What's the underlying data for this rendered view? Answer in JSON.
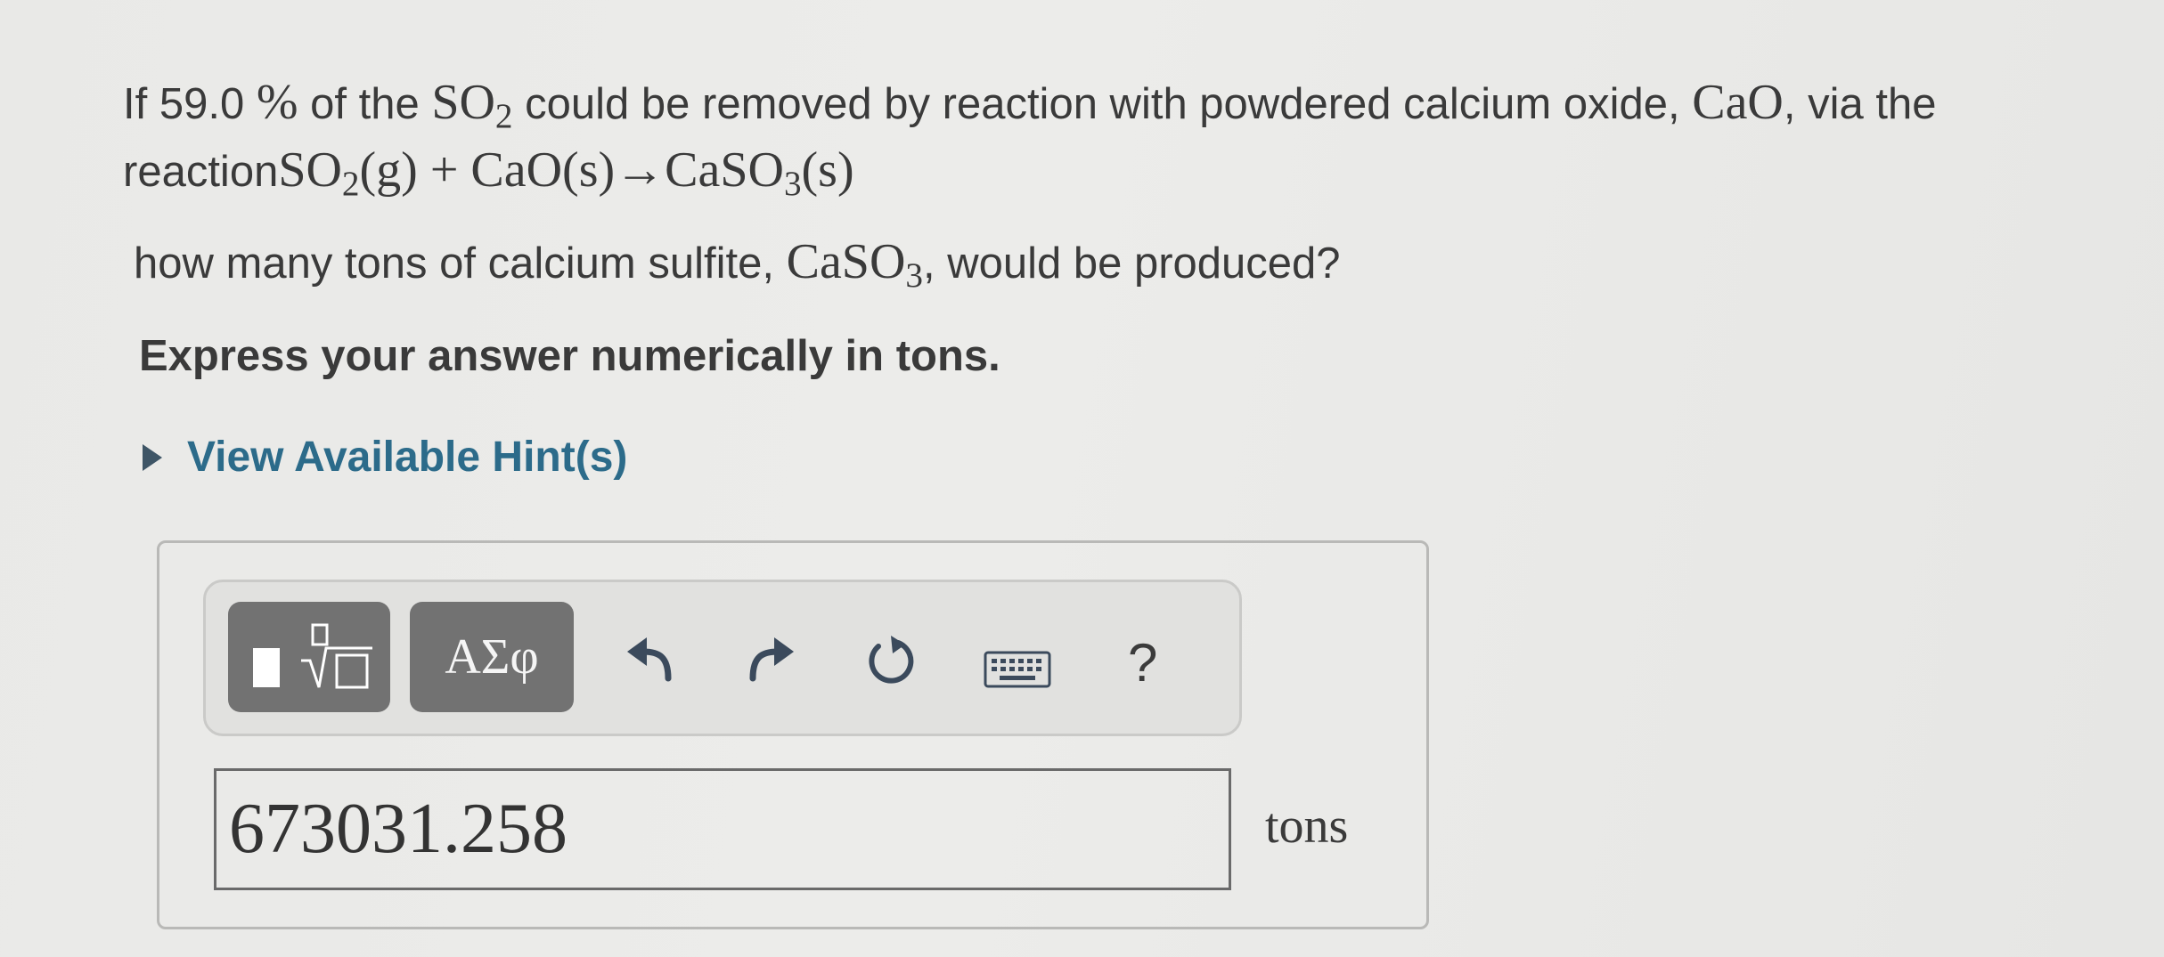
{
  "question": {
    "intro_prefix": "If 59.0",
    "percent_sign": "%",
    "of_the": " of the ",
    "so2_base": "SO",
    "so2_sub": "2",
    "removed_text": " could be removed by reaction with powdered calcium oxide, ",
    "cao": "CaO",
    "via_the": ", via the",
    "reaction_word": "reaction",
    "eq_so2_base": "SO",
    "eq_so2_sub": "2",
    "eq_part2": "(g) + CaO(s)→CaSO",
    "eq_caso3_sub": "3",
    "eq_part3": "(s)",
    "line2_prefix": "how many tons of calcium sulfite, ",
    "caso3_base": "CaSO",
    "caso3_sub": "3",
    "line2_suffix": ", would be produced?",
    "instruction": "Express your answer numerically in tons."
  },
  "hint": {
    "label": "View Available Hint(s)"
  },
  "toolbar": {
    "templates_icon": "templates-icon",
    "greek_label": "ΑΣφ",
    "undo_icon": "undo-icon",
    "redo_icon": "redo-icon",
    "reset_icon": "reset-icon",
    "keyboard_icon": "keyboard-icon",
    "help_label": "?"
  },
  "answer": {
    "value": "673031.258",
    "unit": "tons"
  },
  "colors": {
    "link": "#2c6b8a",
    "button": "#727272",
    "background": "#ececea"
  }
}
